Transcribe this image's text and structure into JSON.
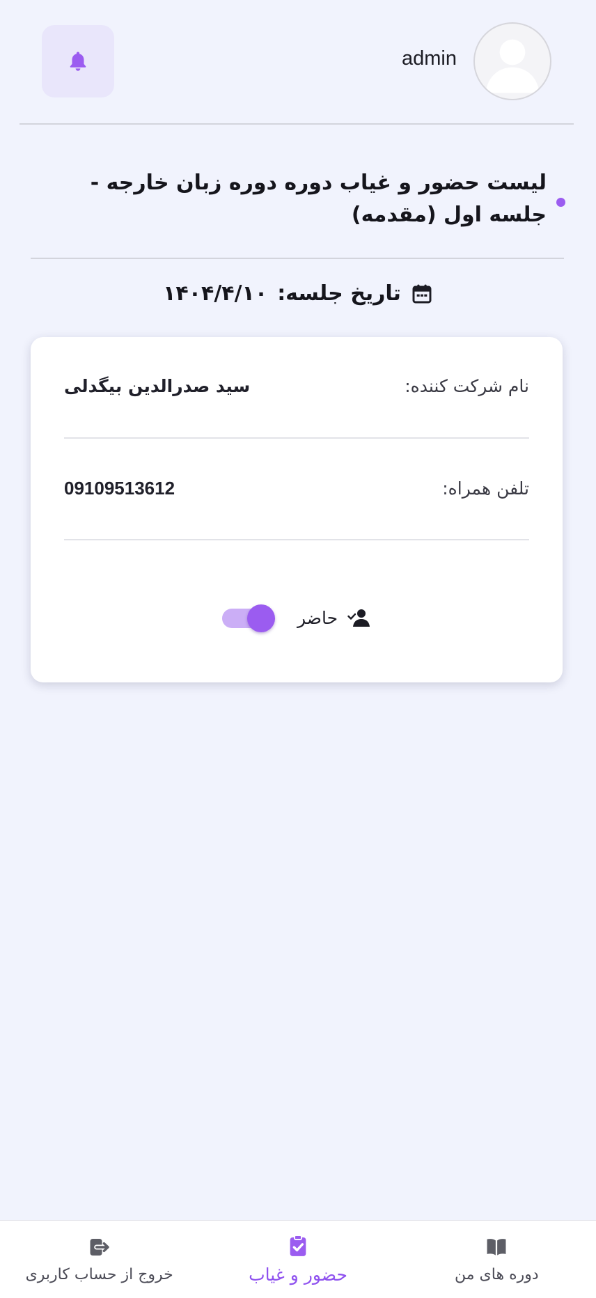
{
  "header": {
    "username": "admin"
  },
  "page": {
    "title": "لیست حضور و غیاب دوره دوره زبان خارجه - جلسه اول (مقدمه)",
    "session_date_label": "تاریخ جلسه:",
    "session_date_value": "۱۴۰۴/۴/۱۰"
  },
  "participant": {
    "name_label": "نام شرکت کننده:",
    "name_value": "سید صدرالدین بیگدلی",
    "phone_label": "تلفن همراه:",
    "phone_value": "09109513612",
    "presence_label": "حاضر",
    "present": true
  },
  "bottom_nav": {
    "items": [
      {
        "label": "دوره های من",
        "icon": "book-open-icon",
        "active": false
      },
      {
        "label": "حضور و غیاب",
        "icon": "clipboard-check-icon",
        "active": true
      },
      {
        "label": "خروج از حساب کاربری",
        "icon": "logout-icon",
        "active": false
      }
    ]
  },
  "colors": {
    "accent": "#9b5cf0",
    "background": "#f1f3fd",
    "card": "#ffffff"
  }
}
